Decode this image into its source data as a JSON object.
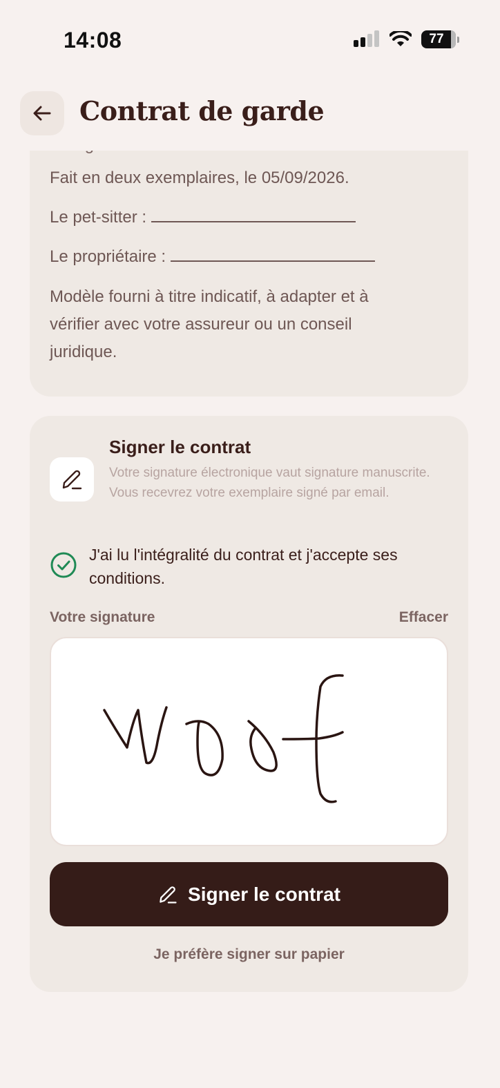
{
  "status_bar": {
    "time": "14:08",
    "battery": "77"
  },
  "header": {
    "title": "Contrat de garde",
    "back_icon": "arrow-left-icon"
  },
  "contract": {
    "cut_off_line": "Le signataire",
    "made_in": "Fait en deux exemplaires, le 05/09/2026.",
    "sitter_label": "Le pet-sitter :",
    "owner_label": "Le propriétaire :",
    "disclaimer": "Modèle fourni à titre indicatif, à adapter et à vérifier avec votre assureur ou un conseil juridique."
  },
  "sign_section": {
    "icon": "pen-icon",
    "title": "Signer le contrat",
    "description": "Votre signature électronique vaut signature manuscrite. Vous recevrez votre exemplaire signé par email.",
    "accept_checked": true,
    "accept_text": "J'ai lu l'intégralité du contrat et j'accepte ses conditions.",
    "signature_label": "Votre signature",
    "clear_label": "Effacer",
    "signature_content": "woof",
    "submit_label": "Signer le contrat",
    "paper_label": "Je préfère signer sur papier"
  },
  "colors": {
    "background": "#F7F1EF",
    "card": "#EFE9E4",
    "primary": "#351C18",
    "check": "#1F8A55",
    "muted_text": "#B7A4A1"
  }
}
